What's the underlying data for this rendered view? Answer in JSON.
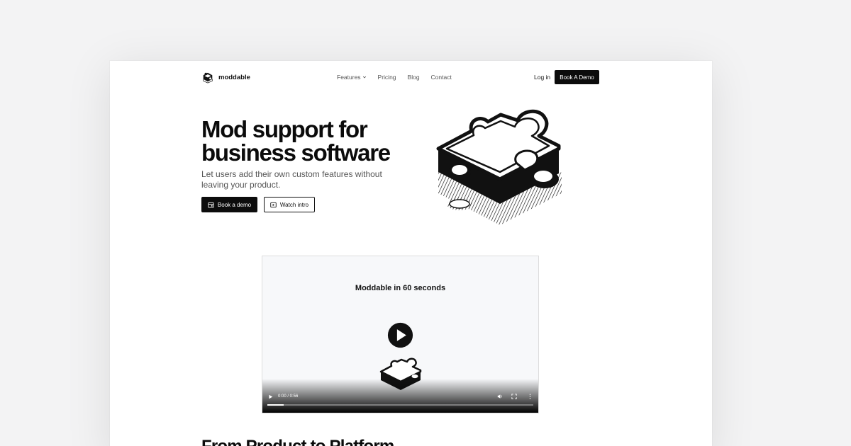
{
  "nav": {
    "brand": "moddable",
    "links": [
      {
        "label": "Features",
        "has_dropdown": true
      },
      {
        "label": "Pricing"
      },
      {
        "label": "Blog"
      },
      {
        "label": "Contact"
      }
    ],
    "login": "Log in",
    "cta": "Book A Demo"
  },
  "hero": {
    "title": "Mod support for business software",
    "subtitle": "Let users add their own custom features without leaving your product.",
    "primary_button": "Book a demo",
    "primary_icon": "calendar-icon",
    "secondary_button": "Watch intro",
    "secondary_icon": "play-icon",
    "art_icon": "puzzle-piece-icon"
  },
  "video": {
    "title": "Moddable in 60 seconds",
    "time": "0:00 / 0:56",
    "progress": 0.0
  },
  "section": {
    "title": "From Product to Platform"
  },
  "colors": {
    "primary": "#0c0c0c",
    "background": "#f3f3f4",
    "card": "#ffffff",
    "muted_text": "#555555"
  }
}
